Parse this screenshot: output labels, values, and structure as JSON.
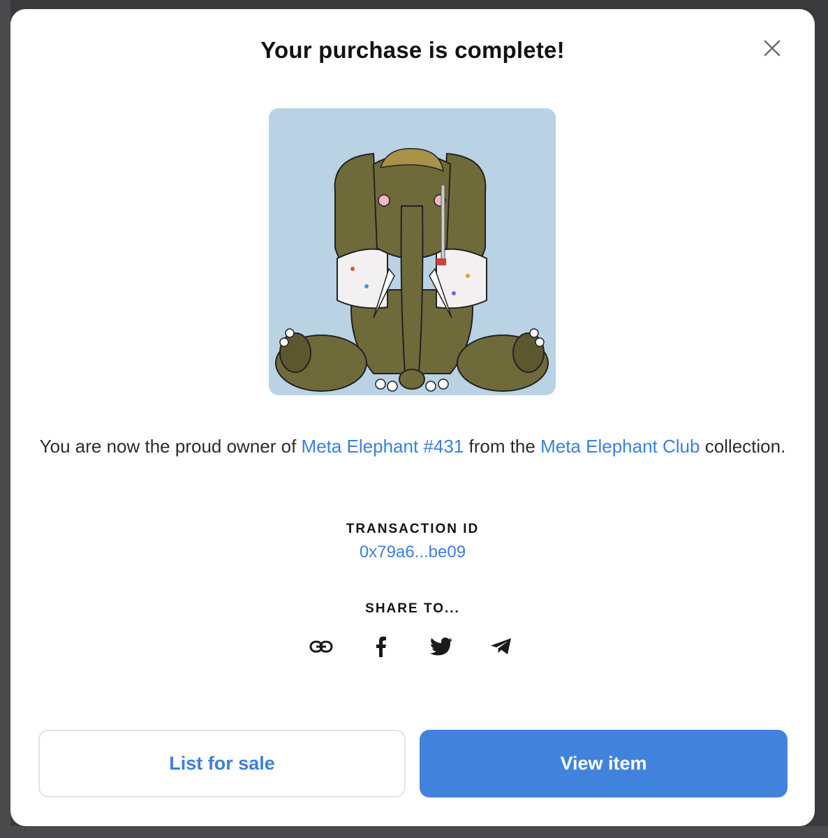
{
  "modal": {
    "title": "Your purchase is complete!",
    "close_icon": "close-icon"
  },
  "nft": {
    "image_icon": "elephant-nft-image",
    "background_color": "#b9d2e4"
  },
  "message": {
    "prefix": "You are now the proud owner of ",
    "item_name": "Meta Elephant #431",
    "middle": " from the ",
    "collection_name": "Meta Elephant Club",
    "suffix": " collection."
  },
  "transaction": {
    "label": "TRANSACTION ID",
    "id": "0x79a6...be09"
  },
  "share": {
    "label": "SHARE TO...",
    "icons": [
      "link-icon",
      "facebook-icon",
      "twitter-icon",
      "telegram-icon"
    ]
  },
  "buttons": {
    "list_for_sale": "List for sale",
    "view_item": "View item"
  },
  "colors": {
    "accent": "#3b7fdc",
    "primary_button": "#4183dc",
    "title": "#121212"
  }
}
